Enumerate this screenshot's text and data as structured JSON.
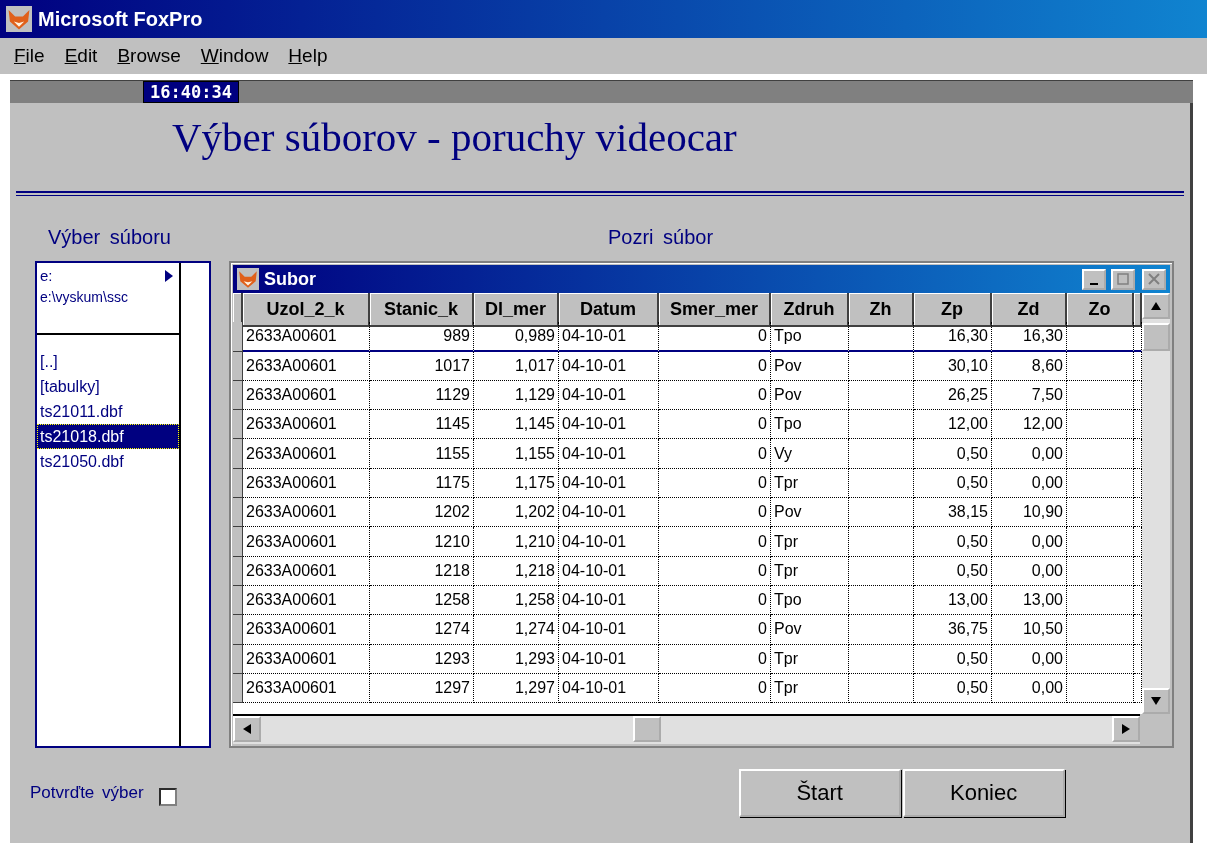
{
  "window": {
    "title": "Microsoft FoxPro"
  },
  "menu": [
    "File",
    "Edit",
    "Browse",
    "Window",
    "Help"
  ],
  "clock": "16:40:34",
  "heading": "Výber súborov - poruchy videocar",
  "file_picker": {
    "label": "Výber súboru",
    "drive": "e:",
    "path": "e:\\vyskum\\ssc",
    "items": [
      {
        "label": "[..]",
        "selected": false
      },
      {
        "label": "[tabulky]",
        "selected": false
      },
      {
        "label": "ts21011.dbf",
        "selected": false
      },
      {
        "label": "ts21018.dbf",
        "selected": true
      },
      {
        "label": "ts21050.dbf",
        "selected": false
      }
    ]
  },
  "browse": {
    "label": "Pozri súbor",
    "window_title": "Subor",
    "columns": [
      {
        "label": "Uzol_2_k",
        "kind": "text"
      },
      {
        "label": "Stanic_k",
        "kind": "number"
      },
      {
        "label": "Dl_mer",
        "kind": "number"
      },
      {
        "label": "Datum",
        "kind": "text"
      },
      {
        "label": "Smer_mer",
        "kind": "number"
      },
      {
        "label": "Zdruh",
        "kind": "text"
      },
      {
        "label": "Zh",
        "kind": "text"
      },
      {
        "label": "Zp",
        "kind": "number"
      },
      {
        "label": "Zd",
        "kind": "number"
      },
      {
        "label": "Zo",
        "kind": "text"
      }
    ],
    "rows": [
      {
        "selected": true,
        "cells": [
          "2633A00601",
          "989",
          "0,989",
          "04-10-01",
          "0",
          "Tpo",
          null,
          "16,30",
          "16,30",
          null
        ]
      },
      {
        "selected": false,
        "cells": [
          "2633A00601",
          "1017",
          "1,017",
          "04-10-01",
          "0",
          "Pov",
          null,
          "30,10",
          "8,60",
          null
        ]
      },
      {
        "selected": false,
        "cells": [
          "2633A00601",
          "1129",
          "1,129",
          "04-10-01",
          "0",
          "Pov",
          null,
          "26,25",
          "7,50",
          null
        ]
      },
      {
        "selected": false,
        "cells": [
          "2633A00601",
          "1145",
          "1,145",
          "04-10-01",
          "0",
          "Tpo",
          null,
          "12,00",
          "12,00",
          null
        ]
      },
      {
        "selected": false,
        "cells": [
          "2633A00601",
          "1155",
          "1,155",
          "04-10-01",
          "0",
          "Vy",
          null,
          "0,50",
          "0,00",
          null
        ]
      },
      {
        "selected": false,
        "cells": [
          "2633A00601",
          "1175",
          "1,175",
          "04-10-01",
          "0",
          "Tpr",
          null,
          "0,50",
          "0,00",
          null
        ]
      },
      {
        "selected": false,
        "cells": [
          "2633A00601",
          "1202",
          "1,202",
          "04-10-01",
          "0",
          "Pov",
          null,
          "38,15",
          "10,90",
          null
        ]
      },
      {
        "selected": false,
        "cells": [
          "2633A00601",
          "1210",
          "1,210",
          "04-10-01",
          "0",
          "Tpr",
          null,
          "0,50",
          "0,00",
          null
        ]
      },
      {
        "selected": false,
        "cells": [
          "2633A00601",
          "1218",
          "1,218",
          "04-10-01",
          "0",
          "Tpr",
          null,
          "0,50",
          "0,00",
          null
        ]
      },
      {
        "selected": false,
        "cells": [
          "2633A00601",
          "1258",
          "1,258",
          "04-10-01",
          "0",
          "Tpo",
          null,
          "13,00",
          "13,00",
          null
        ]
      },
      {
        "selected": false,
        "cells": [
          "2633A00601",
          "1274",
          "1,274",
          "04-10-01",
          "0",
          "Pov",
          null,
          "36,75",
          "10,50",
          null
        ]
      },
      {
        "selected": false,
        "cells": [
          "2633A00601",
          "1293",
          "1,293",
          "04-10-01",
          "0",
          "Tpr",
          null,
          "0,50",
          "0,00",
          null
        ]
      },
      {
        "selected": false,
        "cells": [
          "2633A00601",
          "1297",
          "1,297",
          "04-10-01",
          "0",
          "Tpr",
          null,
          "0,50",
          "0,00",
          null
        ]
      }
    ]
  },
  "confirm": {
    "label": "Potvrďte výber",
    "checked": false
  },
  "buttons": [
    "Štart",
    "Koniec"
  ]
}
